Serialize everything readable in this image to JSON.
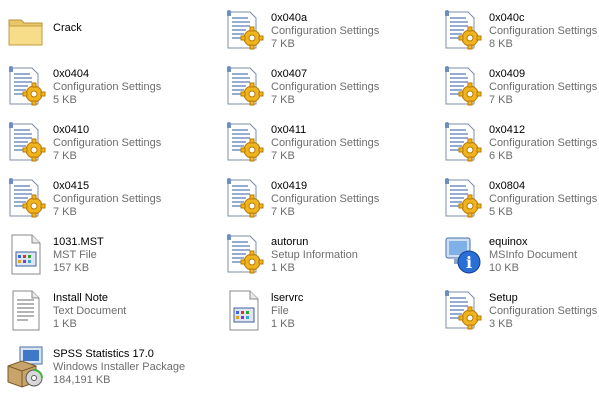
{
  "files": [
    {
      "name": "Crack",
      "type": "",
      "size": "",
      "icon": "folder-icon"
    },
    {
      "name": "0x040a",
      "type": "Configuration Settings",
      "size": "7 KB",
      "icon": "config-settings-icon"
    },
    {
      "name": "0x040c",
      "type": "Configuration Settings",
      "size": "8 KB",
      "icon": "config-settings-icon"
    },
    {
      "name": "0x0404",
      "type": "Configuration Settings",
      "size": "5 KB",
      "icon": "config-settings-icon"
    },
    {
      "name": "0x0407",
      "type": "Configuration Settings",
      "size": "7 KB",
      "icon": "config-settings-icon"
    },
    {
      "name": "0x0409",
      "type": "Configuration Settings",
      "size": "7 KB",
      "icon": "config-settings-icon"
    },
    {
      "name": "0x0410",
      "type": "Configuration Settings",
      "size": "7 KB",
      "icon": "config-settings-icon"
    },
    {
      "name": "0x0411",
      "type": "Configuration Settings",
      "size": "7 KB",
      "icon": "config-settings-icon"
    },
    {
      "name": "0x0412",
      "type": "Configuration Settings",
      "size": "6 KB",
      "icon": "config-settings-icon"
    },
    {
      "name": "0x0415",
      "type": "Configuration Settings",
      "size": "7 KB",
      "icon": "config-settings-icon"
    },
    {
      "name": "0x0419",
      "type": "Configuration Settings",
      "size": "7 KB",
      "icon": "config-settings-icon"
    },
    {
      "name": "0x0804",
      "type": "Configuration Settings",
      "size": "5 KB",
      "icon": "config-settings-icon"
    },
    {
      "name": "1031.MST",
      "type": "MST File",
      "size": "157 KB",
      "icon": "mst-file-icon"
    },
    {
      "name": "autorun",
      "type": "Setup Information",
      "size": "1 KB",
      "icon": "config-settings-icon"
    },
    {
      "name": "equinox",
      "type": "MSInfo Document",
      "size": "10 KB",
      "icon": "msinfo-document-icon"
    },
    {
      "name": "Install Note",
      "type": "Text Document",
      "size": "1 KB",
      "icon": "text-document-icon"
    },
    {
      "name": "lservrc",
      "type": "File",
      "size": "1 KB",
      "icon": "generic-file-icon"
    },
    {
      "name": "Setup",
      "type": "Configuration Settings",
      "size": "3 KB",
      "icon": "config-settings-icon"
    },
    {
      "name": "SPSS Statistics 17.0",
      "type": "Windows Installer Package",
      "size": "184,191 KB",
      "icon": "installer-package-icon"
    }
  ]
}
